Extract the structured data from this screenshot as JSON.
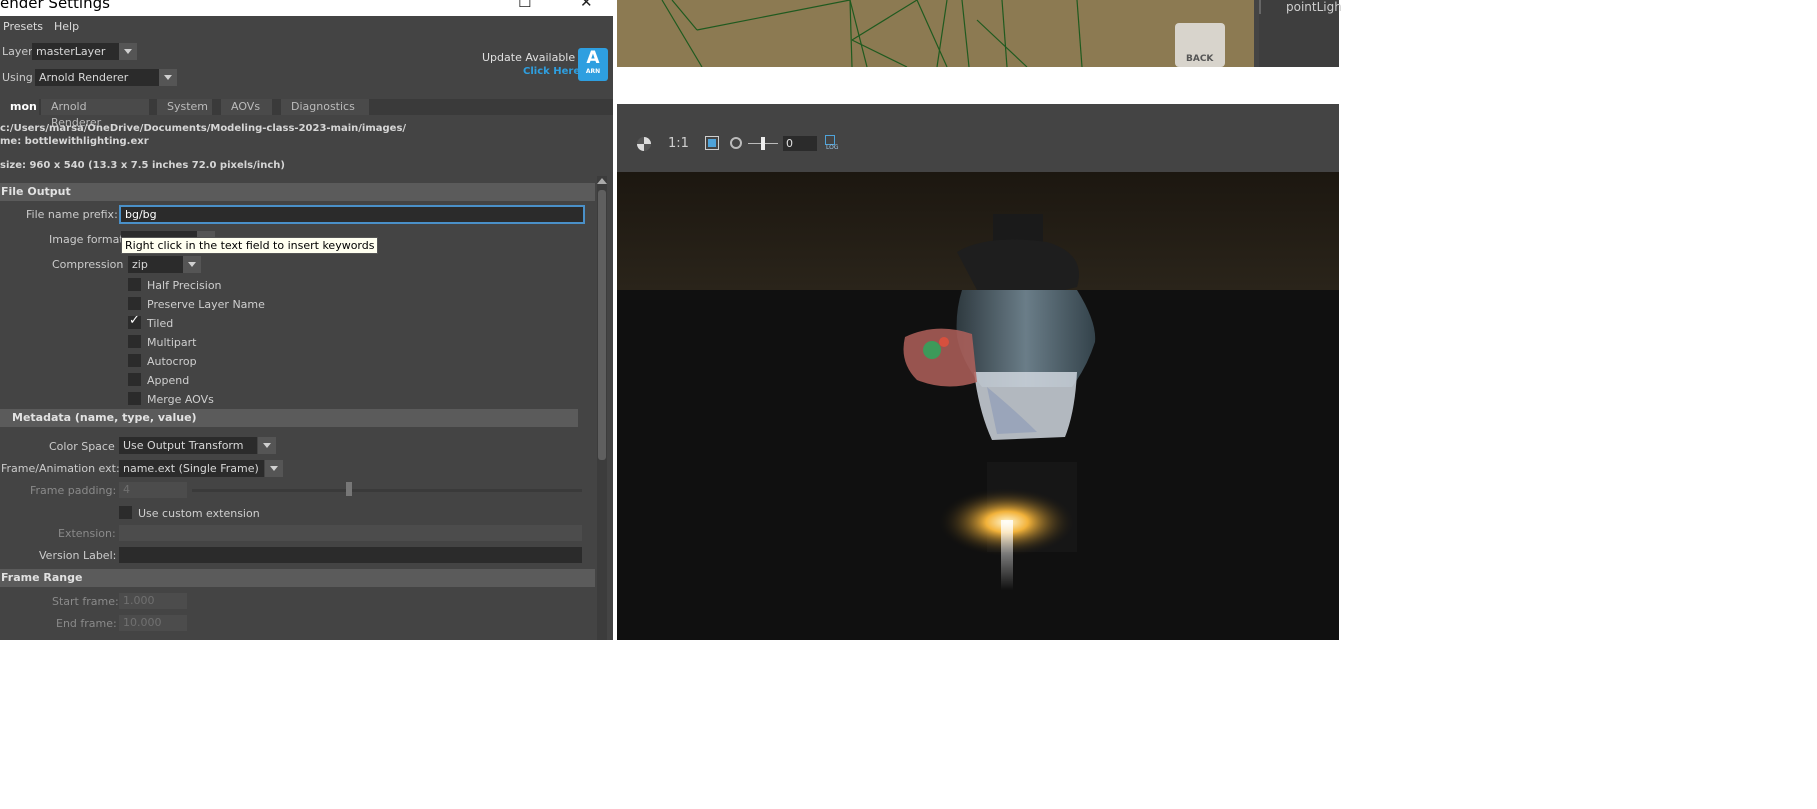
{
  "window": {
    "title": "ender Settings",
    "maximize_glyph": "☐",
    "close_glyph": "✕"
  },
  "menu": {
    "presets": "Presets",
    "help": "Help"
  },
  "layer": {
    "label": "Layer",
    "value": "masterLayer"
  },
  "renderer": {
    "label": "Using",
    "value": "Arnold Renderer"
  },
  "update": {
    "title": "Update Available",
    "link": "Click Here",
    "badge_letter": "A",
    "badge_text": "ARN"
  },
  "tabs": [
    {
      "label": "mon",
      "active": true
    },
    {
      "label": "Arnold Renderer",
      "active": false
    },
    {
      "label": "System",
      "active": false
    },
    {
      "label": "AOVs",
      "active": false
    },
    {
      "label": "Diagnostics",
      "active": false
    }
  ],
  "info": {
    "path": "c:/Users/marsa/OneDrive/Documents/Modeling-class-2023-main/images/",
    "name": "me:  bottlewithlighting.exr",
    "size": "size: 960 x 540 (13.3 x 7.5 inches 72.0 pixels/inch)"
  },
  "file_output": {
    "section_title": "File Output",
    "prefix_label": "File name prefix:",
    "prefix_value": "bg/bg",
    "image_format_label": "Image format:",
    "tooltip": "Right click in the text field to insert keywords",
    "compression_label": "Compression",
    "compression_value": "zip",
    "checkboxes": [
      {
        "label": "Half Precision",
        "checked": false
      },
      {
        "label": "Preserve Layer Name",
        "checked": false
      },
      {
        "label": "Tiled",
        "checked": true
      },
      {
        "label": "Multipart",
        "checked": false
      },
      {
        "label": "Autocrop",
        "checked": false
      },
      {
        "label": "Append",
        "checked": false
      },
      {
        "label": "Merge AOVs",
        "checked": false
      }
    ]
  },
  "metadata": {
    "section_title": "Metadata (name, type, value)"
  },
  "color_space": {
    "label": "Color Space",
    "value": "Use Output Transform"
  },
  "frame_anim": {
    "label": "Frame/Animation ext:",
    "value": "name.ext (Single Frame)"
  },
  "frame_padding": {
    "label": "Frame padding:",
    "value": "4"
  },
  "custom_ext": {
    "label": "Use custom extension",
    "checked": false
  },
  "extension": {
    "label": "Extension:",
    "value": ""
  },
  "version_label": {
    "label": "Version Label:",
    "value": ""
  },
  "frame_range": {
    "section_title": "Frame Range",
    "start_label": "Start frame:",
    "start_value": "1.000",
    "end_label": "End frame:",
    "end_value": "10.000"
  },
  "viewport": {
    "back_label": "BACK",
    "outliner_item": "pointLigh"
  },
  "render_view": {
    "ratio_label": "1:1",
    "exposure_value": "0",
    "log_label": "LOG"
  },
  "colors": {
    "panel_bg": "#444444",
    "field_bg": "#2b2b2b",
    "accent_blue": "#2e9fe0",
    "focus_border": "#4a90c8"
  }
}
